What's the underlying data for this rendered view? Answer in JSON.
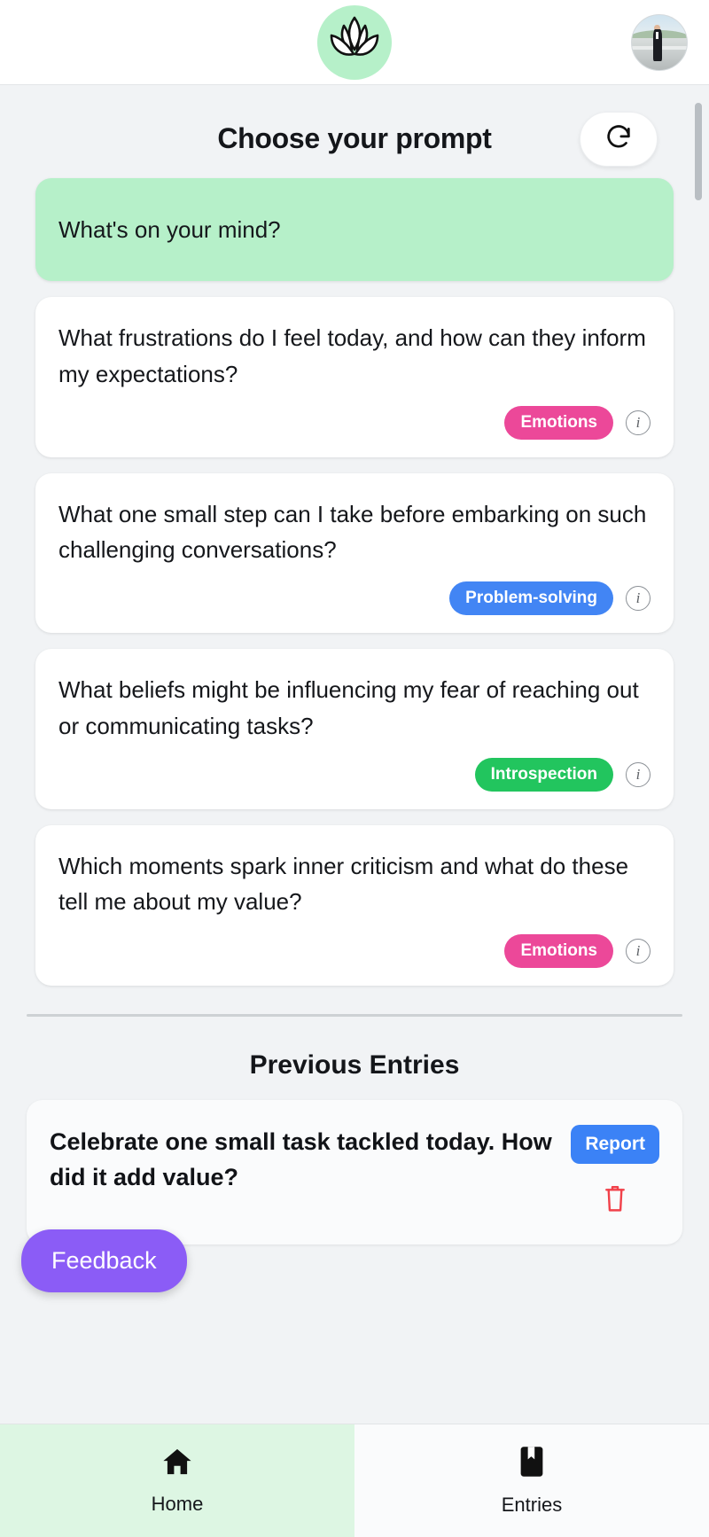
{
  "header": {
    "logo_icon": "lotus-icon",
    "avatar_alt": "user-avatar",
    "avatar_label": "Profile"
  },
  "main": {
    "title": "Choose your prompt",
    "refresh_icon": "refresh-icon",
    "refresh_label": "Refresh prompts"
  },
  "featured_prompt": {
    "text": "What's on your mind?",
    "bg_color": "#b6f0c9"
  },
  "prompts": [
    {
      "text": "What frustrations do I feel today, and how can they inform my expectations?",
      "badge": "Emotions",
      "badge_color": "#ec4899",
      "info_icon": "info-icon"
    },
    {
      "text": "What one small step can I take before embarking on such challenging conversations?",
      "badge": "Problem-solving",
      "badge_color": "#4285f4",
      "info_icon": "info-icon"
    },
    {
      "text": "What beliefs might be influencing my fear of reaching out or communicating tasks?",
      "badge": "Introspection",
      "badge_color": "#22c55e",
      "info_icon": "info-icon"
    },
    {
      "text": "Which moments spark inner criticism and what do these tell me about my value?",
      "badge": "Emotions",
      "badge_color": "#ec4899",
      "info_icon": "info-icon"
    }
  ],
  "previous": {
    "section_title": "Previous Entries",
    "entries": [
      {
        "text": "Celebrate one small task tackled today. How did it add value?",
        "report_label": "Report",
        "delete_icon": "trash-icon",
        "delete_color": "#f1414a"
      }
    ]
  },
  "feedback": {
    "label": "Feedback",
    "color": "#8b5cf6"
  },
  "bottom_nav": [
    {
      "label": "Home",
      "icon": "home-icon",
      "active": true
    },
    {
      "label": "Entries",
      "icon": "book-icon",
      "active": false
    }
  ]
}
